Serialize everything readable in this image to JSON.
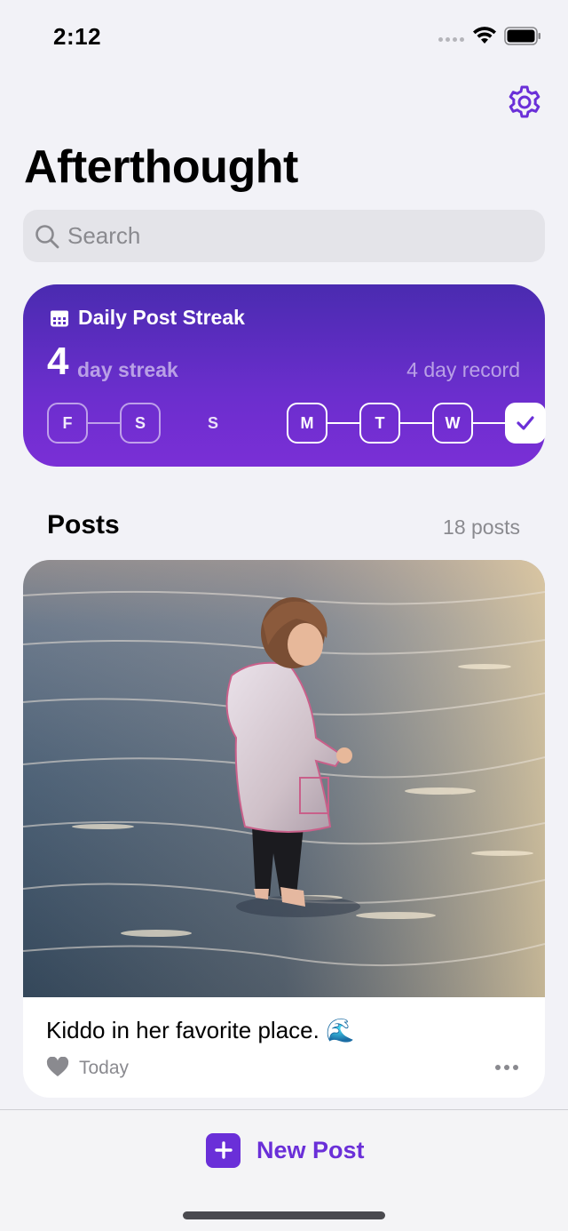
{
  "status_bar": {
    "time": "2:12",
    "icons": [
      "signal-dots-icon",
      "wifi-icon",
      "battery-icon"
    ]
  },
  "header": {
    "settings_icon": "gear-icon",
    "title": "Afterthought"
  },
  "search": {
    "placeholder": "Search",
    "icon": "search-icon"
  },
  "streak": {
    "icon": "calendar-icon",
    "title": "Daily Post Streak",
    "count": "4",
    "unit": "day streak",
    "record": "4 day record",
    "days": [
      {
        "label": "F",
        "state": "posted"
      },
      {
        "label": "S",
        "state": "posted"
      },
      {
        "label": "S",
        "state": "missed"
      },
      {
        "label": "M",
        "state": "posted"
      },
      {
        "label": "T",
        "state": "posted"
      },
      {
        "label": "W",
        "state": "posted"
      },
      {
        "label": "",
        "state": "today-done",
        "icon": "checkmark-icon"
      }
    ]
  },
  "posts": {
    "heading": "Posts",
    "count_label": "18 posts",
    "items": [
      {
        "caption": "Kiddo in her favorite place. 🌊",
        "date": "Today",
        "liked_icon": "heart-icon",
        "more_icon": "ellipsis-icon"
      }
    ]
  },
  "bottom_bar": {
    "new_post_label": "New Post",
    "new_post_icon": "plus-icon"
  },
  "colors": {
    "accent": "#6a2fd8",
    "background": "#f2f2f7",
    "streak_gradient_top": "#4a2bb0",
    "streak_gradient_bottom": "#7a2fd6",
    "secondary_text": "#8a8a8f"
  }
}
